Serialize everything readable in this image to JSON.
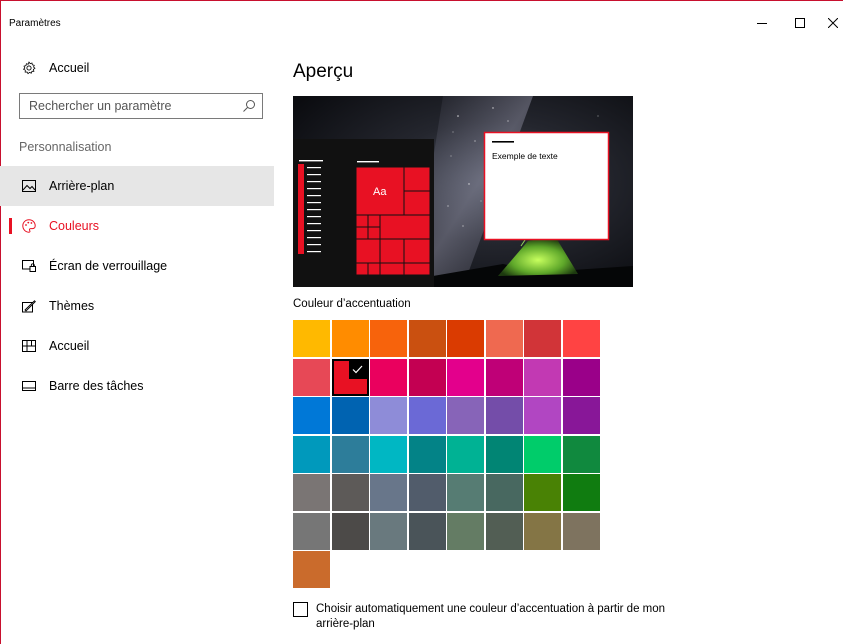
{
  "window": {
    "title": "Paramètres",
    "controls": [
      "minimize-icon",
      "maximize-icon",
      "close-icon"
    ]
  },
  "sidebar": {
    "home": {
      "label": "Accueil",
      "icon": "gear-icon"
    },
    "search": {
      "placeholder": "Rechercher un paramètre",
      "icon": "search-icon"
    },
    "section_label": "Personnalisation",
    "items": [
      {
        "label": "Arrière-plan",
        "icon": "picture-icon",
        "state": "hover"
      },
      {
        "label": "Couleurs",
        "icon": "palette-icon",
        "state": "active"
      },
      {
        "label": "Écran de verrouillage",
        "icon": "lock-screen-icon",
        "state": "normal"
      },
      {
        "label": "Thèmes",
        "icon": "themes-icon",
        "state": "normal"
      },
      {
        "label": "Accueil",
        "icon": "start-icon",
        "state": "normal"
      },
      {
        "label": "Barre des tâches",
        "icon": "taskbar-icon",
        "state": "normal"
      }
    ]
  },
  "main": {
    "title": "Aperçu",
    "preview": {
      "sample_text": "Exemple de texte",
      "tile_text": "Aa",
      "accent_color": "#e81123"
    },
    "accent_label": "Couleur d’accentuation",
    "selected_color": "#e81123",
    "colors": [
      [
        "#ffb900",
        "#ff8c00",
        "#f7630c",
        "#ca5010",
        "#da3b01",
        "#ef6950",
        "#d13438",
        "#ff4343"
      ],
      [
        "#e74856",
        "#e81123",
        "#ea005e",
        "#c30052",
        "#e3008c",
        "#bf0077",
        "#c239b3",
        "#9a0089"
      ],
      [
        "#0078d7",
        "#0063b1",
        "#8e8cd8",
        "#6b69d6",
        "#8764b8",
        "#744da9",
        "#b146c2",
        "#881798"
      ],
      [
        "#0099bc",
        "#2d7d9a",
        "#00b7c3",
        "#038387",
        "#00b294",
        "#018574",
        "#00cc6a",
        "#10893e"
      ],
      [
        "#7a7574",
        "#5d5a58",
        "#68768a",
        "#515c6b",
        "#567c73",
        "#486860",
        "#498205",
        "#107c10"
      ],
      [
        "#767676",
        "#4c4a48",
        "#69797e",
        "#4a5459",
        "#647c64",
        "#525e54",
        "#847545",
        "#7e735f"
      ],
      [
        "#ca6b2c"
      ]
    ],
    "auto_checkbox": {
      "checked": false,
      "label": "Choisir automatiquement une couleur d’accentuation à partir de mon arrière-plan"
    }
  }
}
